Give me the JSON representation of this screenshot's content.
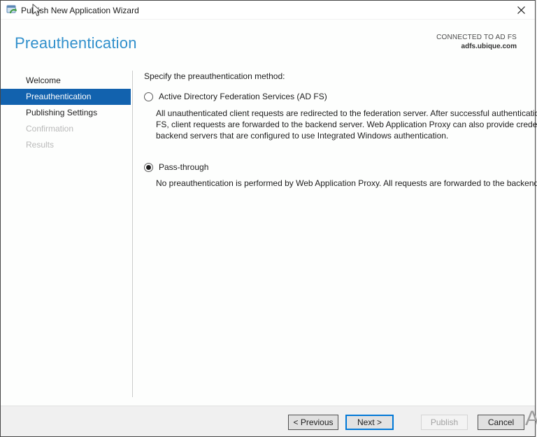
{
  "window": {
    "title": "Publish New Application Wizard",
    "close_glyph": "✕"
  },
  "header": {
    "title": "Preauthentication",
    "connected_label": "CONNECTED TO AD FS",
    "connected_server": "adfs.ubique.com"
  },
  "sidebar": {
    "items": [
      {
        "label": "Welcome",
        "state": "enabled"
      },
      {
        "label": "Preauthentication",
        "state": "selected"
      },
      {
        "label": "Publishing Settings",
        "state": "enabled"
      },
      {
        "label": "Confirmation",
        "state": "disabled"
      },
      {
        "label": "Results",
        "state": "disabled"
      }
    ]
  },
  "content": {
    "prompt": "Specify the preauthentication method:",
    "options": [
      {
        "label": "Active Directory Federation Services (AD FS)",
        "selected": false,
        "description": "All unauthenticated client requests are redirected to the federation server. After successful authentication by AD FS, client requests are forwarded to the backend server. Web Application Proxy can also provide credentials to backend servers that are configured to use Integrated Windows authentication."
      },
      {
        "label": "Pass-through",
        "selected": true,
        "description": "No preauthentication is performed by Web Application Proxy. All requests are forwarded to the backend server."
      }
    ]
  },
  "footer": {
    "buttons": [
      {
        "label": "< Previous",
        "state": "enabled"
      },
      {
        "label": "Next >",
        "state": "default"
      },
      {
        "label": "Publish",
        "state": "disabled"
      },
      {
        "label": "Cancel",
        "state": "enabled"
      }
    ]
  },
  "background": {
    "watermark": "A"
  },
  "colors": {
    "heading_blue": "#3190cc",
    "selection_blue": "#1262ae",
    "focus_border": "#0078d7",
    "footer_gray": "#f0f0f0"
  }
}
